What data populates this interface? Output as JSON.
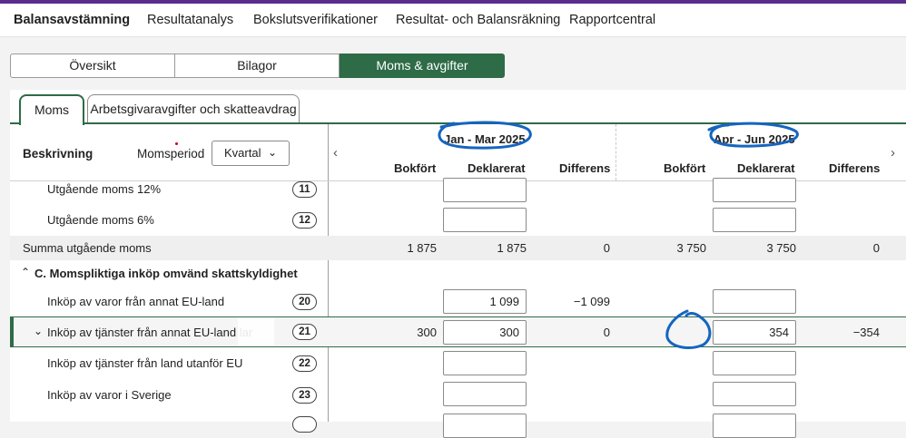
{
  "nav": {
    "items": [
      "Balansavstämning",
      "Resultatanalys",
      "Bokslutsverifikationer",
      "Resultat- och Balansräkning",
      "Rapportcentral"
    ],
    "active": "Balansavstämning"
  },
  "segments": [
    "Översikt",
    "Bilagor",
    "Moms & avgifter"
  ],
  "tabs": [
    "Moms",
    "Arbetsgivaravgifter och skatteavdrag"
  ],
  "header": {
    "description_label": "Beskrivning",
    "period_label": "Momsperiod",
    "period_select": "Kvartal",
    "period1": "Jan - Mar 2025",
    "period2": "Apr - Jun 2025",
    "col_bokfort": "Bokfört",
    "col_deklarerat": "Deklarerat",
    "col_differens": "Differens"
  },
  "rows": {
    "r11": {
      "label": "Utgående moms 12%",
      "badge": "11"
    },
    "r12": {
      "label": "Utgående moms 6%",
      "badge": "12"
    },
    "summa": {
      "label": "Summa utgående moms",
      "p1_bokfort": "1 875",
      "p1_deklarerat": "1 875",
      "p1_differens": "0",
      "p2_bokfort": "3 750",
      "p2_deklarerat": "3 750",
      "p2_differens": "0"
    },
    "sectionC": {
      "label": "C. Momspliktiga inköp omvänd skattskyldighet"
    },
    "r20": {
      "label": "Inköp av varor från annat EU-land",
      "badge": "20",
      "p1_deklarerat": "1 099",
      "p1_differens": "−1 099"
    },
    "r21": {
      "label": "Inköp av tjänster från annat EU-land lar",
      "badge": "21",
      "p1_bokfort": "300",
      "p1_deklarerat": "300",
      "p1_differens": "0",
      "p2_deklarerat": "354",
      "p2_differens": "−354"
    },
    "r22": {
      "label": "Inköp av tjänster från land utanför EU",
      "badge": "22"
    },
    "r23": {
      "label": "Inköp av varor i Sverige",
      "badge": "23"
    }
  },
  "colors": {
    "accent": "#2e6b47",
    "brand": "#5b2d8e",
    "annotation": "#1565c0"
  },
  "icons": [
    "chevron-down-icon",
    "chevron-left-icon",
    "chevron-right-icon",
    "chevron-up-icon"
  ]
}
